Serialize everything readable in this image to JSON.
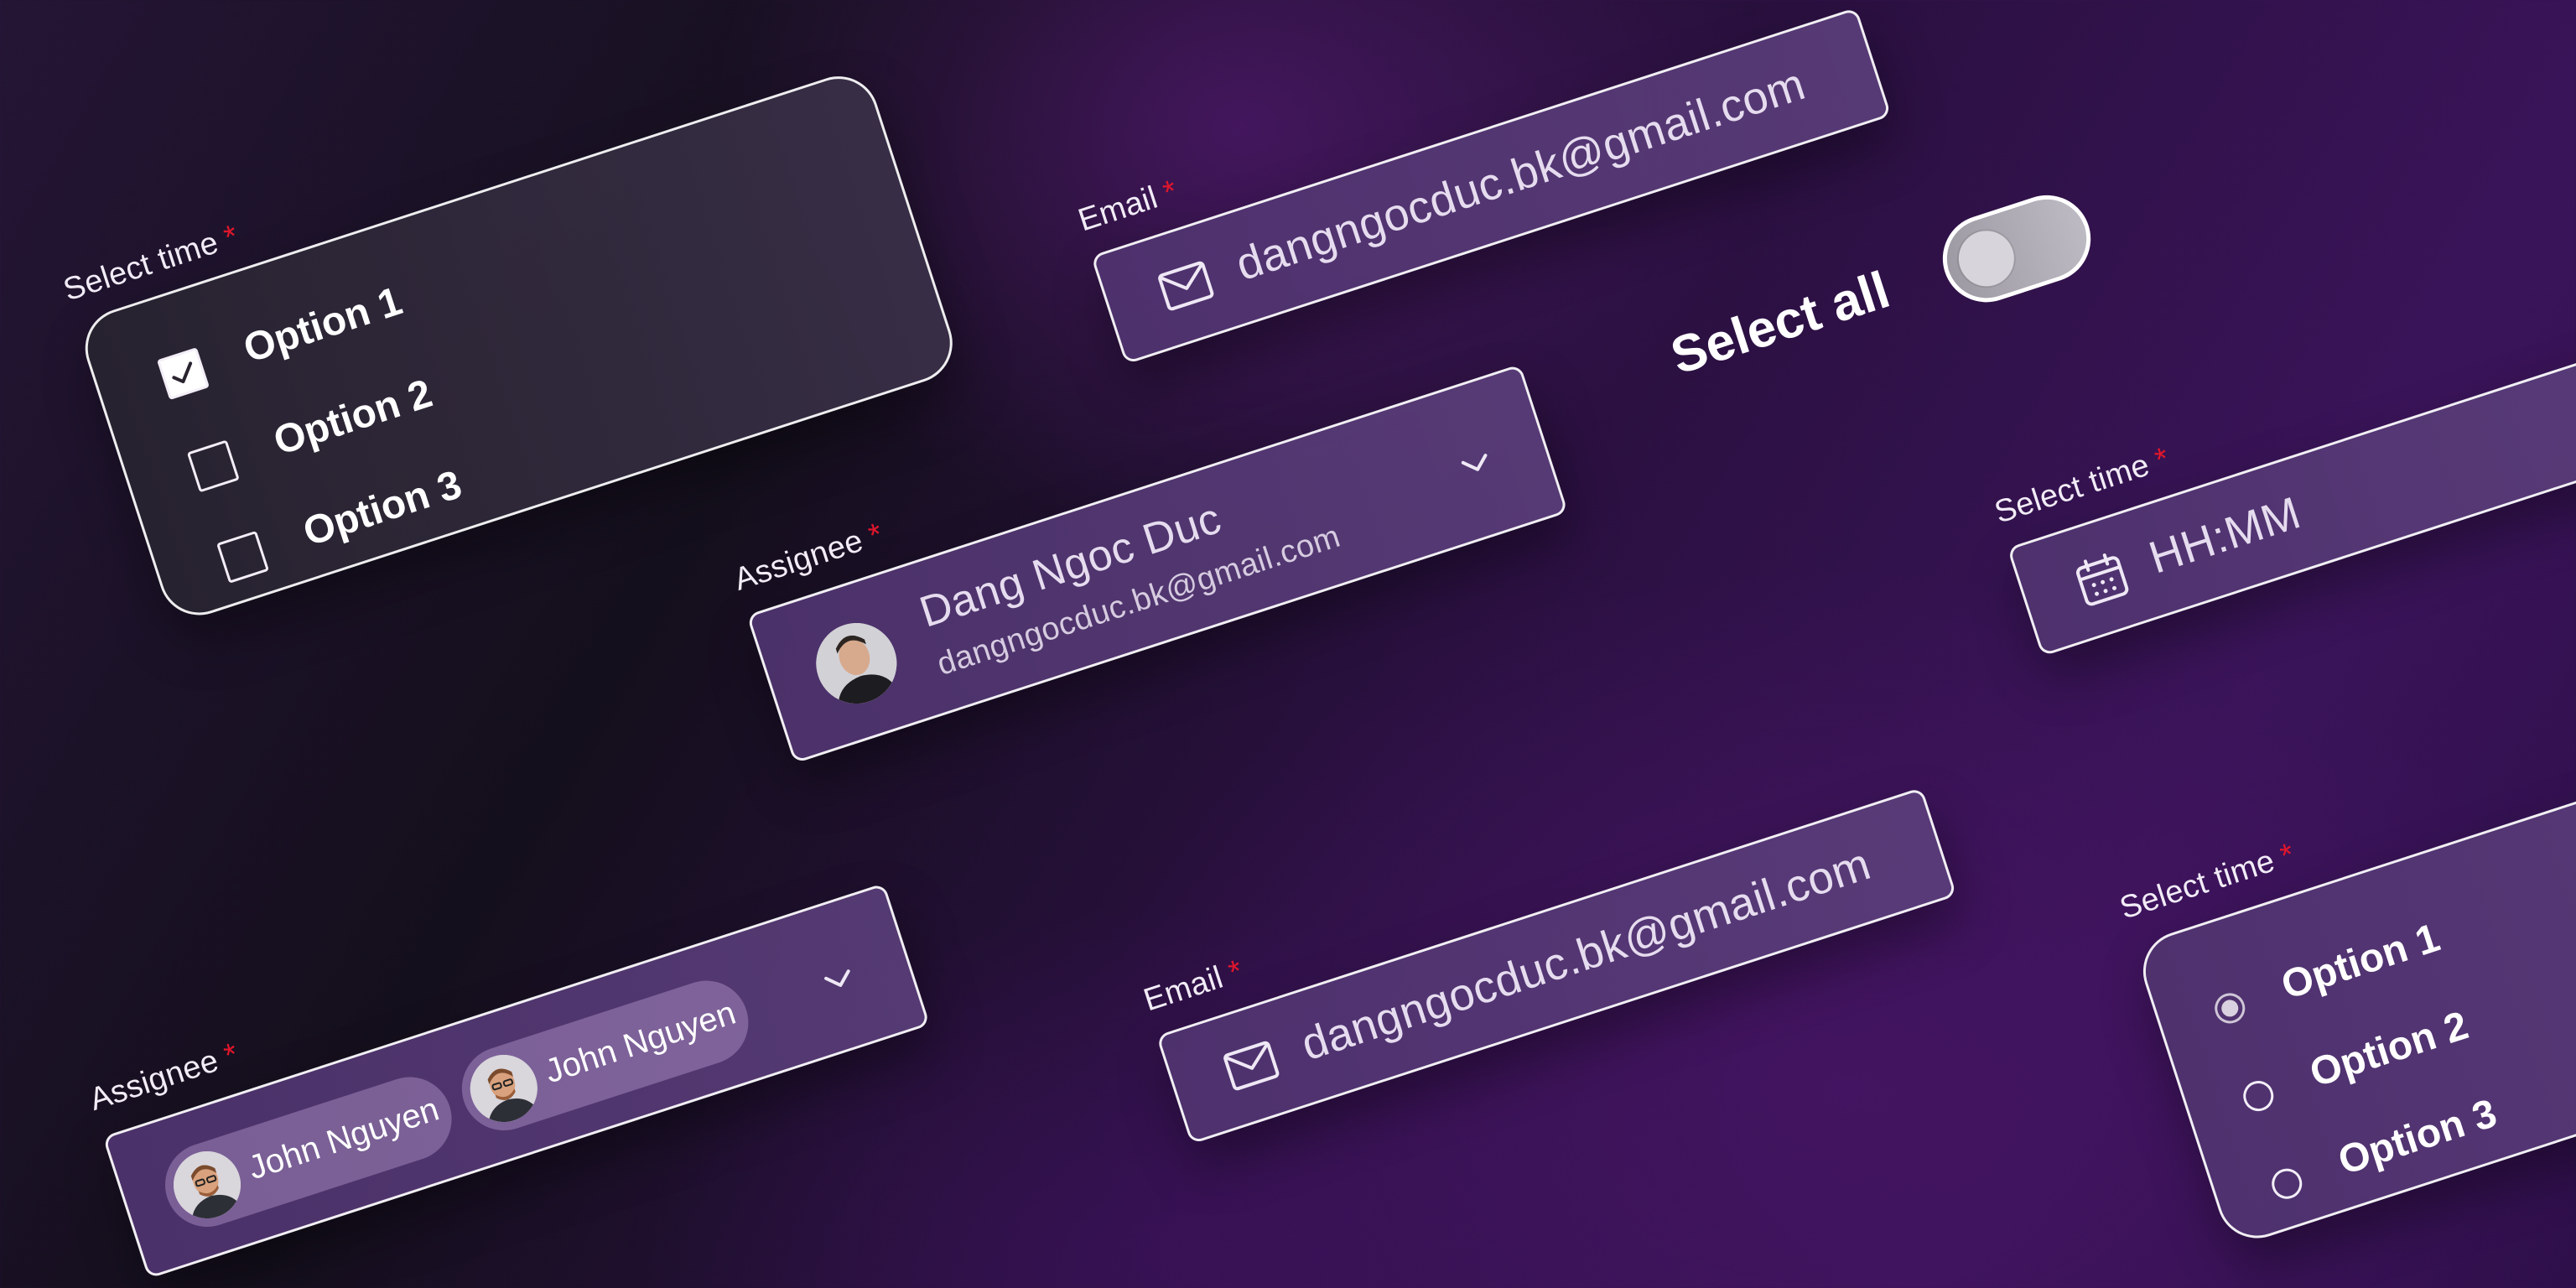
{
  "checkbox_group": {
    "label": "Select time",
    "required_mark": "*",
    "options": [
      "Option 1",
      "Option 2",
      "Option 3"
    ],
    "checked": [
      true,
      false,
      false
    ]
  },
  "email_top": {
    "label": "Email",
    "required_mark": "*",
    "value": "dangngocduc.bk@gmail.com",
    "icon": "mail-icon"
  },
  "select_all_toggle": {
    "label": "Select all",
    "state": "off"
  },
  "assignee_single": {
    "label": "Assignee",
    "required_mark": "*",
    "name": "Dang Ngoc Duc",
    "email": "dangngocduc.bk@gmail.com",
    "icon": "chevron-down-icon"
  },
  "time_input": {
    "label": "Select time",
    "required_mark": "*",
    "placeholder": "HH:MM",
    "icon": "calendar-icon"
  },
  "assignee_multi": {
    "label": "Assignee",
    "required_mark": "*",
    "chips": [
      "John Nguyen",
      "John Nguyen"
    ],
    "icon": "chevron-down-icon"
  },
  "email_bottom": {
    "label": "Email",
    "required_mark": "*",
    "value": "dangngocduc.bk@gmail.com",
    "icon": "mail-icon"
  },
  "radio_group": {
    "label": "Select time",
    "required_mark": "*",
    "options": [
      "Option 1",
      "Option 2",
      "Option 3"
    ],
    "selected_index": 0
  },
  "colors": {
    "required": "#e0162b",
    "border": "#ffffff"
  }
}
